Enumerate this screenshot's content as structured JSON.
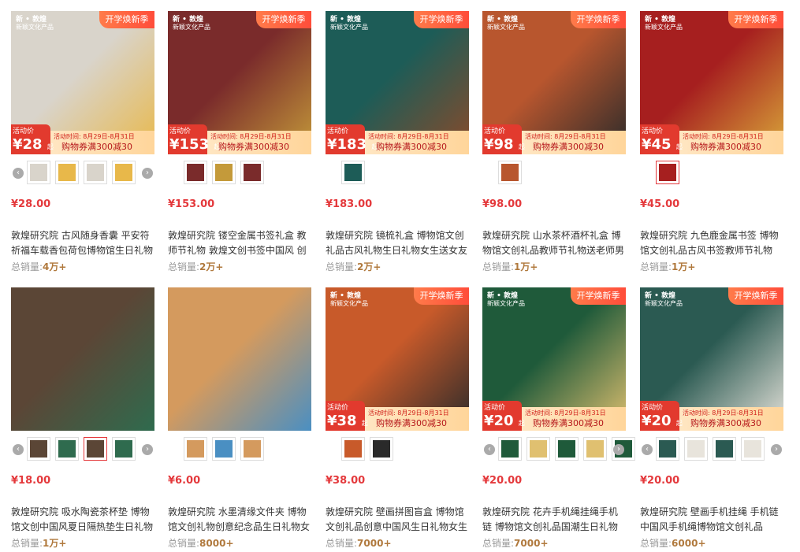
{
  "logo": {
    "line1": "新 • 敦煌",
    "line2": "新颖文化产品"
  },
  "promo": {
    "label": "活动价",
    "unit": "¥",
    "suffix": "起",
    "time": "活动时间: 8月29日-8月31日",
    "coupon": "购物券满300减30"
  },
  "badge": "开学焕新季",
  "sales_label": "总销量:",
  "products": [
    {
      "price": "¥28.00",
      "promo_price": "28",
      "title": "敦煌研究院 古风随身香囊 平安符祈福车载香包荷包博物馆生日礼物",
      "sales": "4万+",
      "show_badge": true,
      "thumbs": 4,
      "sel": -1,
      "colors": [
        "#d9d4cb",
        "#e8b84a"
      ]
    },
    {
      "price": "¥153.00",
      "promo_price": "153",
      "title": "敦煌研究院 镂空金属书签礼盒 教师节礼物 敦煌文创书签中国风 创",
      "sales": "2万+",
      "show_badge": true,
      "thumbs": 3,
      "sel": -1,
      "colors": [
        "#7a2b2b",
        "#c49a3a"
      ]
    },
    {
      "price": "¥183.00",
      "promo_price": "183",
      "title": "敦煌研究院 镜梳礼盒 博物馆文创礼品古风礼物生日礼物女生送女友",
      "sales": "2万+",
      "show_badge": true,
      "thumbs": 1,
      "sel": -1,
      "colors": [
        "#1d5c57",
        "#8a4a2a"
      ]
    },
    {
      "price": "¥98.00",
      "promo_price": "98",
      "title": "敦煌研究院 山水茶杯酒杯礼盒 博物馆文创礼品教师节礼物送老师男",
      "sales": "1万+",
      "show_badge": true,
      "thumbs": 1,
      "sel": -1,
      "colors": [
        "#b8562e",
        "#2a2a2a"
      ]
    },
    {
      "price": "¥45.00",
      "promo_price": "45",
      "title": "敦煌研究院 九色鹿金属书签 博物馆文创礼品古风书签教师节礼物",
      "sales": "1万+",
      "show_badge": true,
      "thumbs": 1,
      "sel": 0,
      "colors": [
        "#a61f1f",
        "#d9a73a"
      ]
    },
    {
      "price": "¥18.00",
      "promo_price": "",
      "title": "敦煌研究院 吸水陶瓷茶杯垫 博物馆文创中国风夏日隔热垫生日礼物",
      "sales": "1万+",
      "show_badge": false,
      "thumbs": 4,
      "sel": 2,
      "colors": [
        "#5b4636",
        "#2f6b4e"
      ]
    },
    {
      "price": "¥6.00",
      "promo_price": "",
      "title": "敦煌研究院 水墨清缘文件夹 博物馆文创礼物创意纪念品生日礼物女",
      "sales": "8000+",
      "show_badge": false,
      "thumbs": 3,
      "sel": -1,
      "colors": [
        "#d49a5e",
        "#4a8fc2"
      ]
    },
    {
      "price": "¥38.00",
      "promo_price": "38",
      "title": "敦煌研究院 壁画拼图盲盒 博物馆文创礼品创意中国风生日礼物女生",
      "sales": "7000+",
      "show_badge": true,
      "thumbs": 2,
      "sel": -1,
      "colors": [
        "#c85a2a",
        "#2a2a2a"
      ]
    },
    {
      "price": "¥20.00",
      "promo_price": "20",
      "title": "敦煌研究院 花卉手机绳挂绳手机链 博物馆文创礼品国潮生日礼物",
      "sales": "7000+",
      "show_badge": true,
      "thumbs": 5,
      "sel": -1,
      "colors": [
        "#1f5a3a",
        "#e0c070"
      ]
    },
    {
      "price": "¥20.00",
      "promo_price": "20",
      "title": "敦煌研究院 壁画手机挂绳 手机链中国风手机绳博物馆文创礼品",
      "sales": "6000+",
      "show_badge": true,
      "thumbs": 4,
      "sel": -1,
      "colors": [
        "#2b5a52",
        "#e8e4dc"
      ]
    }
  ]
}
